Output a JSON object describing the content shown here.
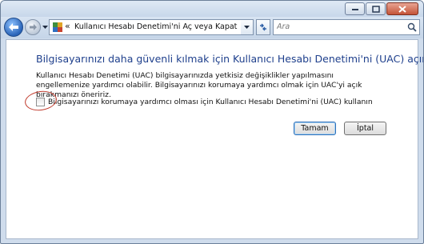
{
  "window": {
    "caption_buttons": [
      "minimize-icon",
      "maximize-icon",
      "close-icon"
    ]
  },
  "navbar": {
    "address_chevron": "«",
    "address_text": "Kullanıcı Hesabı Denetimi'ni Aç veya Kapat",
    "search_placeholder": "Ara",
    "icons": [
      "back-arrow-icon",
      "forward-arrow-icon",
      "control-panel-icon",
      "refresh-icon",
      "search-icon"
    ]
  },
  "content": {
    "heading": "Bilgisayarınızı daha güvenli kılmak için Kullanıcı Hesabı Denetimi'ni (UAC) açın",
    "description": "Kullanıcı Hesabı Denetimi (UAC) bilgisayarınızda yetkisiz değişiklikler yapılmasını engellemenize yardımcı olabilir. Bilgisayarınızı korumaya yardımcı olmak için UAC'yi açık bırakmanızı öneririz.",
    "checkbox_label": "Bilgisayarınızı korumaya yardımcı olması için Kullanıcı Hesabı Denetimi'ni (UAC) kullanın",
    "checkbox_checked": false,
    "annotation_color": "#c0392b"
  },
  "buttons": {
    "ok": "Tamam",
    "cancel": "İptal"
  }
}
